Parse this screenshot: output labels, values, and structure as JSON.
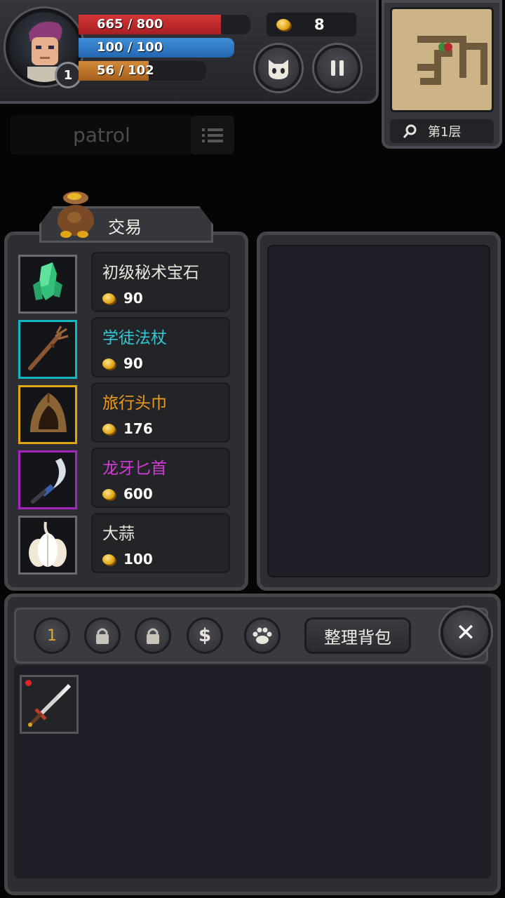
{
  "hud": {
    "level": "1",
    "hp": {
      "text": "665 / 800",
      "fraction": 0.83
    },
    "mp": {
      "text": "100 / 100",
      "fraction": 1.0
    },
    "xp": {
      "text": "56 / 102",
      "fraction": 0.55
    },
    "gold": "8",
    "pet_icon": "pet-face-icon",
    "pause_icon": "pause-icon"
  },
  "minimap": {
    "floor": "第1层",
    "search_icon": "magnifier-icon"
  },
  "patrol": {
    "label": "patrol",
    "menu_icon": "list-icon"
  },
  "trade": {
    "title": "交易",
    "items": [
      {
        "name": "初级秘术宝石",
        "price": "90",
        "rarity": "common",
        "icon": "green-gem-icon"
      },
      {
        "name": "学徒法杖",
        "price": "90",
        "rarity": "rare",
        "icon": "staff-icon"
      },
      {
        "name": "旅行头巾",
        "price": "176",
        "rarity": "epic",
        "icon": "hood-icon"
      },
      {
        "name": "龙牙匕首",
        "price": "600",
        "rarity": "legend",
        "icon": "curved-dagger-icon"
      },
      {
        "name": "大蒜",
        "price": "100",
        "rarity": "common",
        "icon": "garlic-icon"
      }
    ]
  },
  "inventory": {
    "tabs": [
      {
        "label": "1",
        "icon": ""
      },
      {
        "label": "",
        "icon": "lock-icon"
      },
      {
        "label": "",
        "icon": "lock-icon"
      },
      {
        "label": "$",
        "icon": "dollar-icon"
      },
      {
        "label": "",
        "icon": "paw-icon"
      }
    ],
    "sort_label": "整理背包",
    "close_label": "✕",
    "items": [
      {
        "icon": "sword-icon",
        "new": true
      }
    ]
  },
  "colors": {
    "hp": "#c62a2e",
    "mp": "#2f7cc6",
    "xp": "#c07a2e",
    "rare": "#33c7d2",
    "epic": "#f09a1e",
    "legend": "#d43ad8"
  }
}
